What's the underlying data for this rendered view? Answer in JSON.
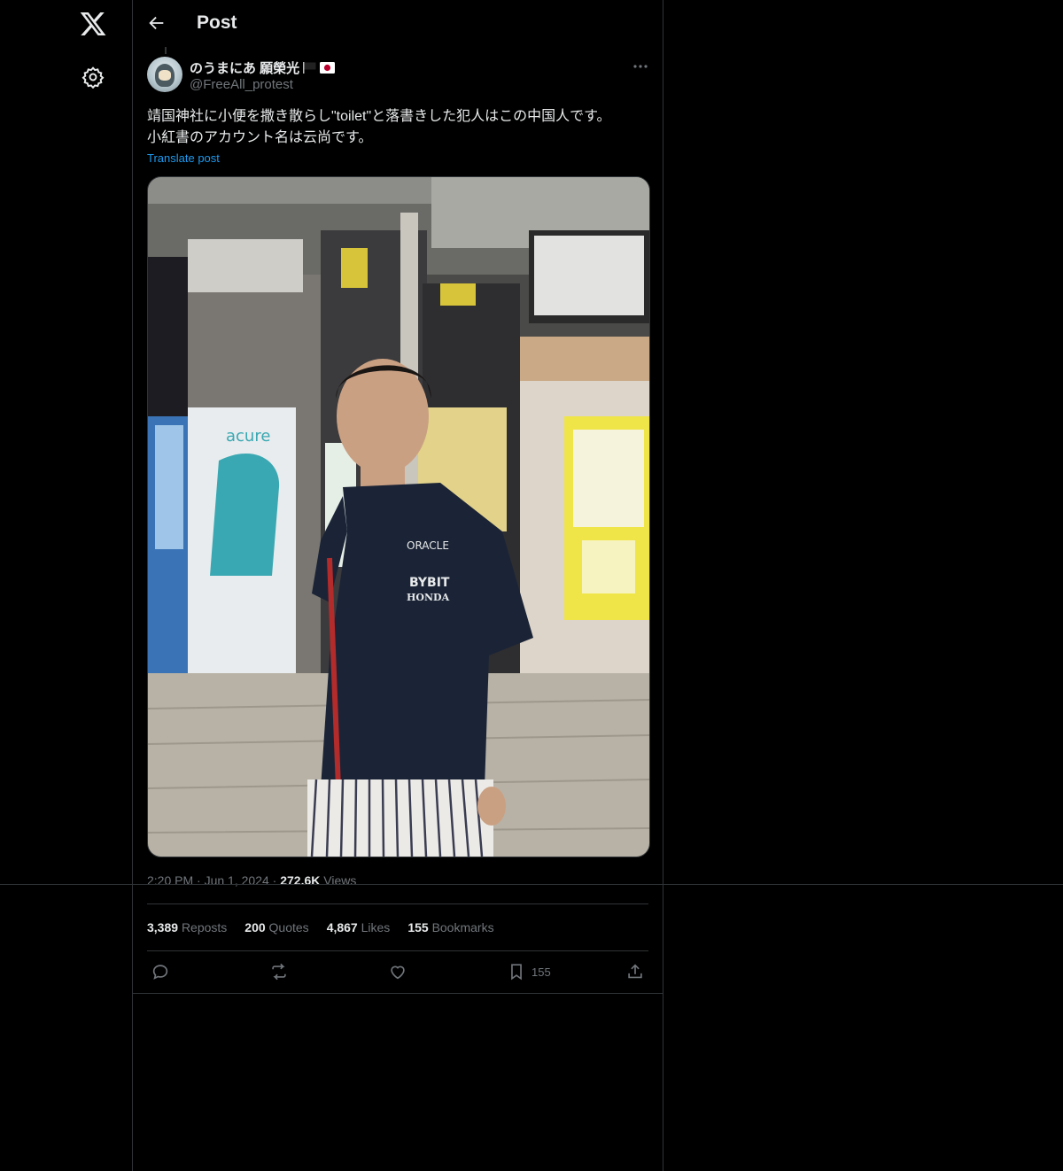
{
  "sidebar": {
    "logo_icon": "x-logo-icon",
    "settings_icon": "gear-icon"
  },
  "header": {
    "back_icon": "arrow-left-icon",
    "title": "Post"
  },
  "post": {
    "author": {
      "name": "のうまにあ 願榮光",
      "flags": [
        "black-flag",
        "japan-flag"
      ],
      "handle": "@FreeAll_protest"
    },
    "text_lines": [
      "靖国神社に小便を撒き散らし\"toilet\"と落書きした犯人はこの中国人です。",
      "小紅書のアカウント名は云尚です。"
    ],
    "translate_label": "Translate post",
    "media_alt": "photo",
    "time": "2:20 PM",
    "date": "Jun 1, 2024",
    "views_count": "272.6K",
    "views_label": "Views",
    "separator": "·",
    "stats": {
      "reposts_count": "3,389",
      "reposts_label": "Reposts",
      "quotes_count": "200",
      "quotes_label": "Quotes",
      "likes_count": "4,867",
      "likes_label": "Likes",
      "bookmarks_count": "155",
      "bookmarks_label": "Bookmarks"
    },
    "actions": {
      "bookmark_count": "155"
    }
  },
  "colors": {
    "background": "#000000",
    "text": "#e7e9ea",
    "muted": "#71767b",
    "accent": "#1d9bf0",
    "border": "#2f3336"
  }
}
